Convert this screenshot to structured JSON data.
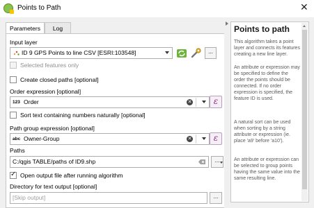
{
  "window": {
    "title": "Points to Path",
    "close": "✕"
  },
  "tabs": [
    {
      "label": "Parameters"
    },
    {
      "label": "Log"
    }
  ],
  "params": {
    "input_layer_label": "Input layer",
    "input_layer_value": "ID 9 GPS Points to line CSV [ESRI:103548]",
    "selected_only_label": "Selected features only",
    "closed_paths_label": "Create closed paths [optional]",
    "order_label": "Order expression [optional]",
    "order_type": "123",
    "order_value": "Order",
    "sort_label": "Sort text containing numbers naturally [optional]",
    "group_label": "Path group expression [optional]",
    "group_type": "abc",
    "group_value": "Owner-Group",
    "paths_label": "Paths",
    "paths_value": "C:/qgis TABLE/paths of ID9.shp",
    "open_output_label": "Open output file after running algorithm",
    "dir_label": "Directory for text output [optional]",
    "dir_placeholder": "[Skip output]",
    "ellipsis": "...",
    "epsilon": "ε",
    "clear": "✕"
  },
  "help": {
    "title": "Points to path",
    "paragraphs": [
      "This algorithm takes a point layer and connects its features creating a new line layer.",
      "An attribute or expression may be specified to define the order the points should be connected. If no order expression is specified, the feature ID is used.",
      "A natural sort can be used when sorting by a string attribute or expression (ie. place 'a9' before 'a10').",
      "An attribute or expression can be selected to group points having the same value into the same resulting line."
    ]
  },
  "state": {
    "selected_only": false,
    "closed_paths": false,
    "sort_natural": false,
    "open_output": true
  }
}
